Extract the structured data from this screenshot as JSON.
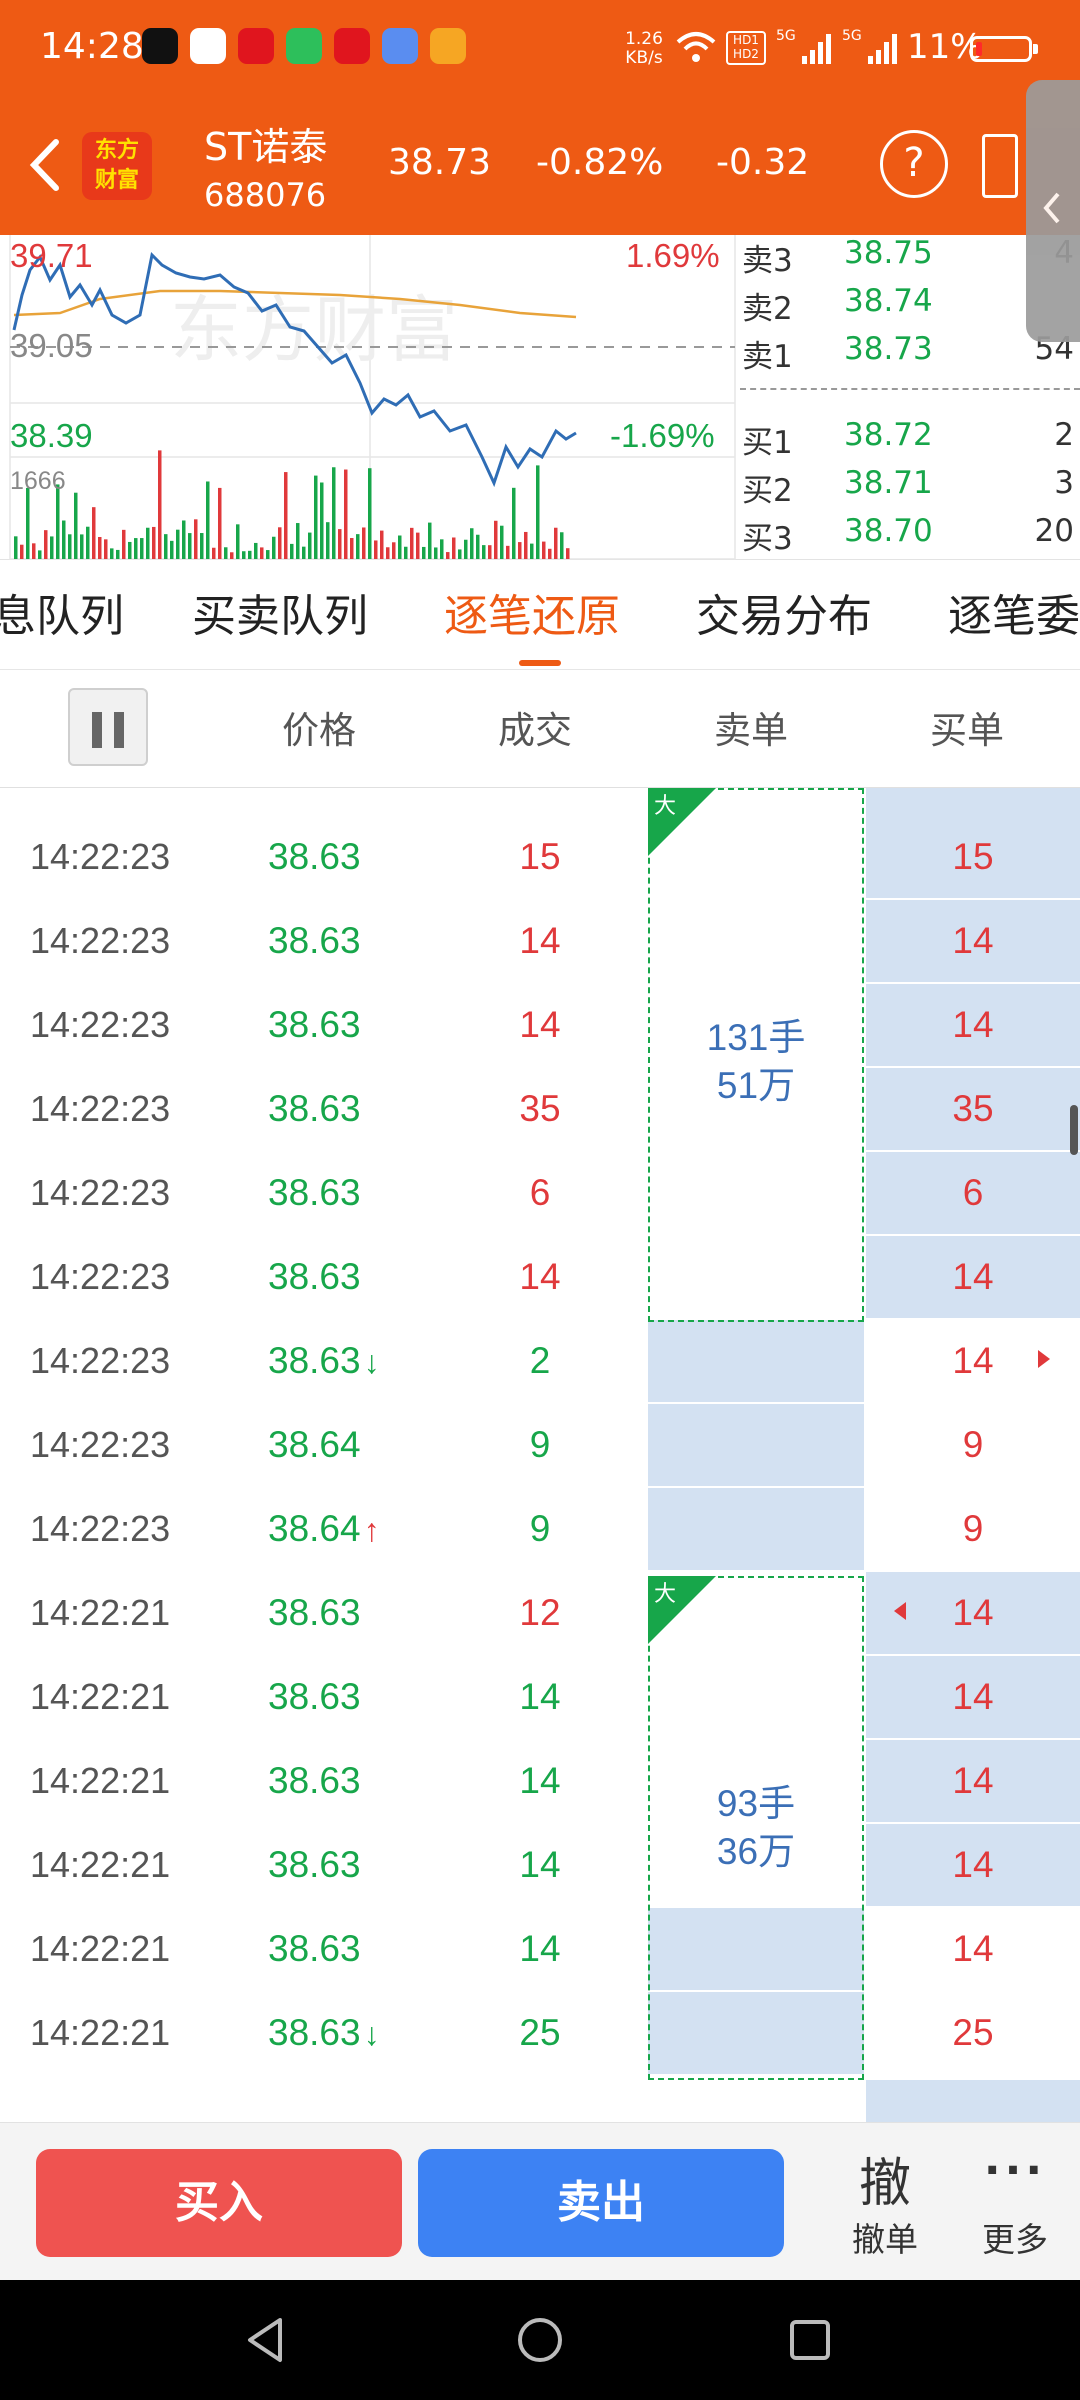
{
  "status_bar": {
    "time": "14:28",
    "net_speed_value": "1.26",
    "net_speed_unit": "KB/s",
    "battery": "11%",
    "battery_level": 0.11
  },
  "header": {
    "logo_line1": "东方",
    "logo_line2": "财富",
    "stock_name": "ST诺泰",
    "stock_code": "688076",
    "price": "38.73",
    "change_pct": "-0.82%",
    "change": "-0.32",
    "help": "?"
  },
  "chart": {
    "high": "39.71",
    "mid": "39.05",
    "low": "38.39",
    "high_pct": "1.69%",
    "low_pct": "-1.69%",
    "volume_max": "1666",
    "watermark": "东方财富",
    "colors": {
      "price_line": "#2f6db5",
      "avg_line": "#e8a33a",
      "up": "#e0393b",
      "down": "#17a64a"
    }
  },
  "orderbook": {
    "asks": [
      {
        "label": "卖3",
        "price": "38.75",
        "vol": "4"
      },
      {
        "label": "卖2",
        "price": "38.74",
        "vol": ""
      },
      {
        "label": "卖1",
        "price": "38.73",
        "vol": "54"
      }
    ],
    "bids": [
      {
        "label": "买1",
        "price": "38.72",
        "vol": "2"
      },
      {
        "label": "买2",
        "price": "38.71",
        "vol": "3"
      },
      {
        "label": "买3",
        "price": "38.70",
        "vol": "20"
      }
    ]
  },
  "tabs": [
    "息队列",
    "买卖队列",
    "逐笔还原",
    "交易分布",
    "逐笔委"
  ],
  "columns": {
    "price": "价格",
    "volume": "成交",
    "sell": "卖单",
    "buy": "买单"
  },
  "trades": [
    {
      "time": "14:22:23",
      "price": "38.63",
      "arrow": "",
      "vol": "15",
      "buy": "15"
    },
    {
      "time": "14:22:23",
      "price": "38.63",
      "arrow": "",
      "vol": "14",
      "buy": "14"
    },
    {
      "time": "14:22:23",
      "price": "38.63",
      "arrow": "",
      "vol": "14",
      "buy": "14"
    },
    {
      "time": "14:22:23",
      "price": "38.63",
      "arrow": "",
      "vol": "35",
      "buy": "35"
    },
    {
      "time": "14:22:23",
      "price": "38.63",
      "arrow": "",
      "vol": "6",
      "buy": "6"
    },
    {
      "time": "14:22:23",
      "price": "38.63",
      "arrow": "",
      "vol": "14",
      "buy": "14"
    },
    {
      "time": "14:22:23",
      "price": "38.63",
      "arrow": "↓",
      "vol": "2",
      "buy": "14"
    },
    {
      "time": "14:22:23",
      "price": "38.64",
      "arrow": "",
      "vol": "9",
      "buy": "9"
    },
    {
      "time": "14:22:23",
      "price": "38.64",
      "arrow": "↑",
      "vol": "9",
      "buy": "9"
    },
    {
      "time": "14:22:21",
      "price": "38.63",
      "arrow": "",
      "vol": "12",
      "buy": "14"
    },
    {
      "time": "14:22:21",
      "price": "38.63",
      "arrow": "",
      "vol": "14",
      "buy": "14"
    },
    {
      "time": "14:22:21",
      "price": "38.63",
      "arrow": "",
      "vol": "14",
      "buy": "14"
    },
    {
      "time": "14:22:21",
      "price": "38.63",
      "arrow": "",
      "vol": "14",
      "buy": "14"
    },
    {
      "time": "14:22:21",
      "price": "38.63",
      "arrow": "",
      "vol": "14",
      "buy": "14"
    },
    {
      "time": "14:22:21",
      "price": "38.63",
      "arrow": "↓",
      "vol": "25",
      "buy": "25"
    }
  ],
  "big_orders": [
    {
      "tag": "大",
      "line1": "131手",
      "line2": "51万"
    },
    {
      "tag": "大",
      "line1": "93手",
      "line2": "36万"
    }
  ],
  "actions": {
    "buy": "买入",
    "sell": "卖出",
    "cancel_icon": "撤",
    "cancel": "撤单",
    "more": "更多"
  }
}
